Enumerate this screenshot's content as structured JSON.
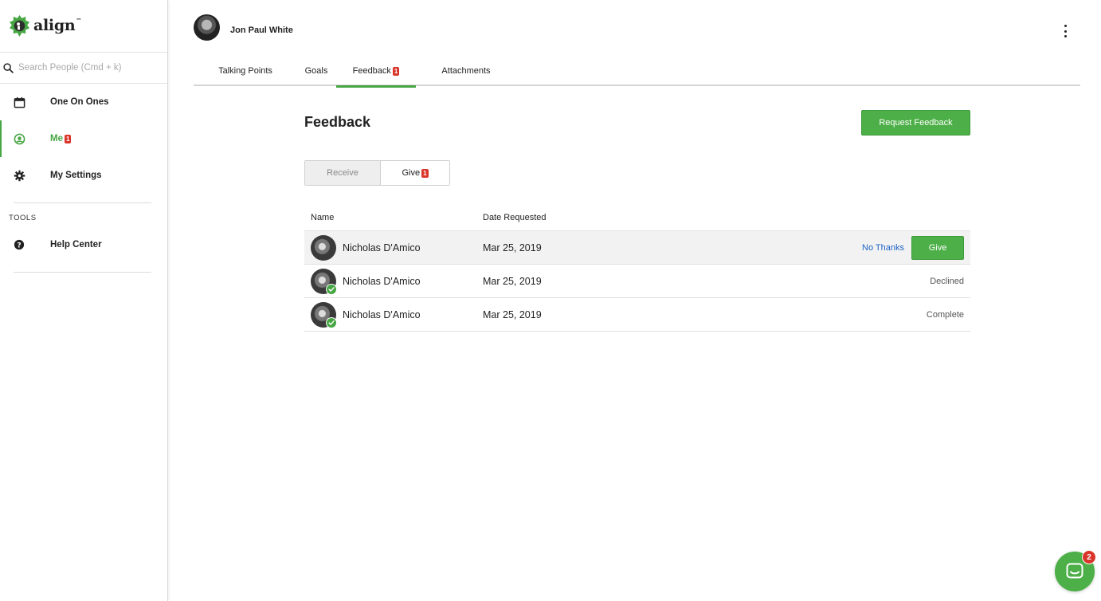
{
  "app": {
    "logo_text": "align",
    "logo_tm": "™"
  },
  "sidebar": {
    "search_placeholder": "Search People (Cmd + k)",
    "items": [
      {
        "label": "One On Ones",
        "icon": "calendar-icon"
      },
      {
        "label": "Me",
        "icon": "user-circle-icon",
        "badge": "1",
        "active": true
      },
      {
        "label": "My Settings",
        "icon": "gear-icon"
      }
    ],
    "tools_label": "TOOLS",
    "tools_items": [
      {
        "label": "Help Center",
        "icon": "help-icon"
      }
    ]
  },
  "header": {
    "user_name": "Jon Paul White",
    "tabs": [
      {
        "label": "Talking Points"
      },
      {
        "label": "Goals"
      },
      {
        "label": "Feedback",
        "badge": "1",
        "active": true
      },
      {
        "label": "Attachments"
      }
    ]
  },
  "main": {
    "title": "Feedback",
    "request_button": "Request Feedback",
    "segments": {
      "receive": "Receive",
      "give": "Give",
      "give_badge": "1"
    },
    "table": {
      "headers": {
        "name": "Name",
        "date": "Date Requested"
      },
      "rows": [
        {
          "name": "Nicholas D'Amico",
          "date": "Mar 25, 2019",
          "no_thanks": "No Thanks",
          "give": "Give"
        },
        {
          "name": "Nicholas D'Amico",
          "date": "Mar 25, 2019",
          "status": "Declined"
        },
        {
          "name": "Nicholas D'Amico",
          "date": "Mar 25, 2019",
          "status": "Complete"
        }
      ]
    }
  },
  "chat": {
    "badge": "2"
  },
  "colors": {
    "accent_green": "#4caf47",
    "badge_red": "#d9352b",
    "link_blue": "#1e64c8"
  }
}
